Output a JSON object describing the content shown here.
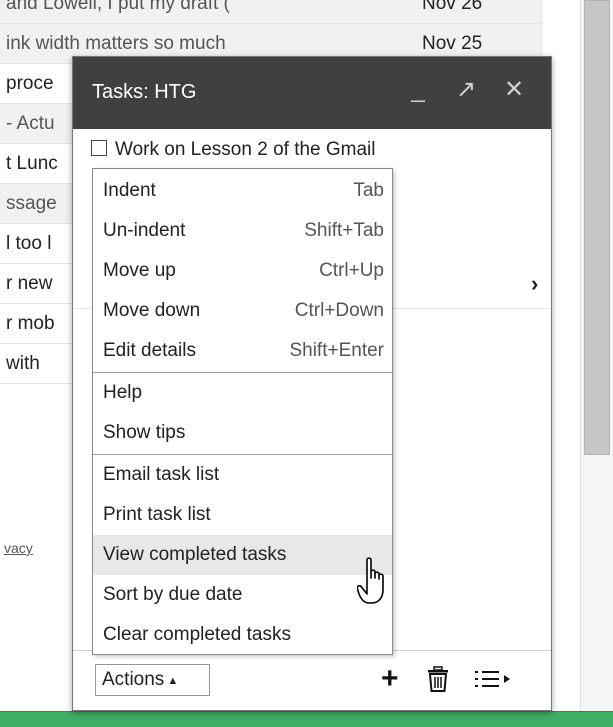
{
  "inbox": {
    "rows": [
      {
        "snippet": "and Lowell, I put my draft (",
        "date": "Nov 26",
        "read": true
      },
      {
        "snippet": "ink width matters so much",
        "date": "Nov 25",
        "read": true
      },
      {
        "snippet": "proce",
        "date": "",
        "read": false
      },
      {
        "snippet": "- Actu",
        "date": "",
        "read": true
      },
      {
        "snippet": "t Lunc",
        "date": "",
        "read": false
      },
      {
        "snippet": "ssage",
        "date": "",
        "read": true
      },
      {
        "snippet": "l too l",
        "date": "",
        "read": false
      },
      {
        "snippet": "r new",
        "date": "",
        "read": false
      },
      {
        "snippet": "r mob",
        "date": "",
        "read": false
      },
      {
        "snippet": " with",
        "date": "",
        "read": false
      }
    ],
    "privacy_link": "vacy"
  },
  "tasks_window": {
    "title": "Tasks: HTG",
    "minimize_glyph": "_",
    "popout_glyph": "↗",
    "close_glyph": "✕",
    "task": "Work on Lesson 2 of the Gmail",
    "next_glyph": "›"
  },
  "actions_menu": {
    "items": [
      {
        "label": "Indent",
        "shortcut": "Tab"
      },
      {
        "label": "Un-indent",
        "shortcut": "Shift+Tab"
      },
      {
        "label": "Move up",
        "shortcut": "Ctrl+Up"
      },
      {
        "label": "Move down",
        "shortcut": "Ctrl+Down"
      },
      {
        "label": "Edit details",
        "shortcut": "Shift+Enter"
      },
      {
        "label": "Help"
      },
      {
        "label": "Show tips"
      },
      {
        "label": "Email task list"
      },
      {
        "label": "Print task list"
      },
      {
        "label": "View completed tasks",
        "highlighted": true
      },
      {
        "label": "Sort by due date"
      },
      {
        "label": "Clear completed tasks"
      }
    ]
  },
  "footer": {
    "actions_label": "Actions",
    "actions_arrow": "▲",
    "add_glyph": "+"
  },
  "icons": {
    "minimize": "minimize-icon",
    "popout": "popout-icon",
    "close": "close-icon",
    "add": "plus-icon",
    "trash": "trash-icon",
    "switch_list": "list-switch-icon",
    "cursor": "hand-cursor-icon"
  },
  "colors": {
    "header_bg": "#404040",
    "highlight_bg": "#e8e8e8",
    "bottom_bar": "#3daf63"
  }
}
